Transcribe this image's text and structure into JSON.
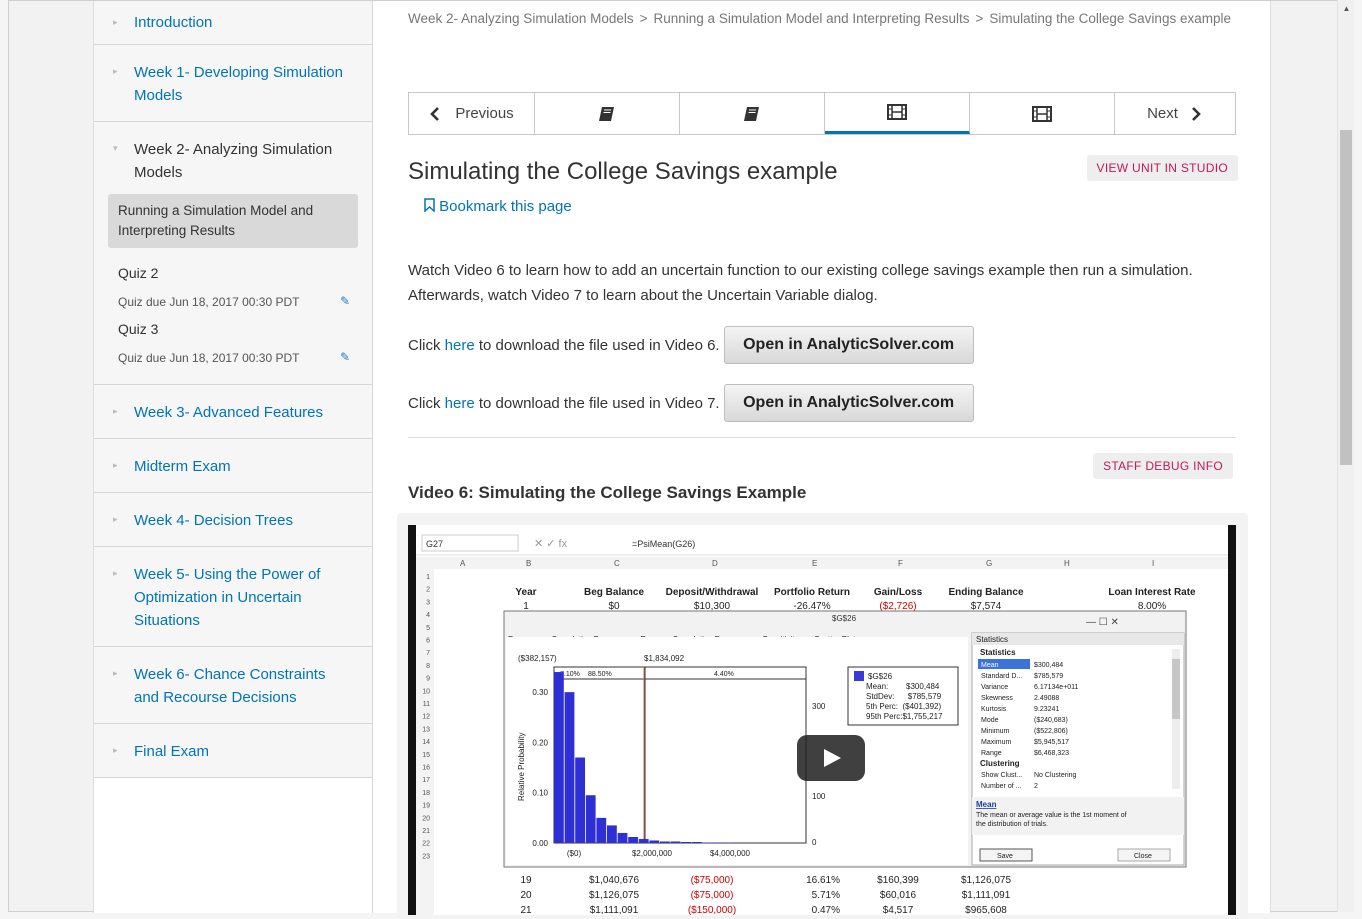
{
  "sidebar": {
    "sections": [
      {
        "title": "Introduction"
      },
      {
        "title": "Week 1- Developing Simulation Models"
      },
      {
        "title": "Week 2- Analyzing Simulation Models"
      },
      {
        "title": "Week 3- Advanced Features"
      },
      {
        "title": "Midterm Exam"
      },
      {
        "title": "Week 4- Decision Trees"
      },
      {
        "title": "Week 5- Using the Power of Optimization in Uncertain Situations"
      },
      {
        "title": "Week 6- Chance Constraints and Recourse Decisions"
      },
      {
        "title": "Final Exam"
      }
    ],
    "week2_items": [
      {
        "title": "Running a Simulation Model and Interpreting Results"
      },
      {
        "title": "Quiz 2",
        "due": "Quiz due Jun 18, 2017 00:30 PDT"
      },
      {
        "title": "Quiz 3",
        "due": "Quiz due Jun 18, 2017 00:30 PDT"
      }
    ]
  },
  "breadcrumb": {
    "part1": "Week 2- Analyzing Simulation Models",
    "part2": "Running a Simulation Model and Interpreting Results",
    "part3": "Simulating the College Savings example",
    "sep": ">"
  },
  "seqnav": {
    "previous": "Previous",
    "next": "Next"
  },
  "unit": {
    "title": "Simulating the College Savings example",
    "studio_button": "VIEW UNIT IN STUDIO",
    "bookmark": "Bookmark this page",
    "intro": "Watch Video 6 to learn how to add an uncertain function to our existing college savings example then run a simulation.  Afterwards, watch Video 7 to learn about the Uncertain Variable dialog.",
    "download1_pre": "Click ",
    "download1_link": "here",
    "download1_post": " to download the file used in Video 6.",
    "download2_pre": "Click ",
    "download2_link": "here",
    "download2_post": " to download the file used in Video 7.",
    "solver_button": "Open in AnalyticSolver.com",
    "debug_button": "STAFF DEBUG INFO",
    "video_title": "Video 6: Simulating the College Savings Example"
  },
  "video": {
    "cell_ref": "G27",
    "formula": "=PsiMean(G26)",
    "columns": [
      "A",
      "B",
      "C",
      "D",
      "E",
      "F",
      "G",
      "H",
      "I"
    ],
    "headers": [
      "Year",
      "Beg Balance",
      "Deposit/Withdrawal",
      "Portfolio Return",
      "Gain/Loss",
      "Ending Balance",
      "Loan Interest Rate"
    ],
    "row3": [
      "1",
      "$0",
      "$10,300",
      "-26.47%",
      "($2,726)",
      "$7,574",
      "8.00%"
    ],
    "bottom_rows": [
      {
        "row": "21",
        "cells": [
          "19",
          "$1,040,676",
          "($75,000)",
          "16.61%",
          "$160,399",
          "$1,126,075"
        ]
      },
      {
        "row": "22",
        "cells": [
          "20",
          "$1,126,075",
          "($75,000)",
          "5.71%",
          "$60,016",
          "$1,111,091"
        ]
      },
      {
        "row": "23",
        "cells": [
          "21",
          "$1,111,091",
          "($150,000)",
          "0.47%",
          "$4,517",
          "$965,608"
        ]
      }
    ],
    "dialog": {
      "title": "$G$26",
      "tabs": [
        "Frequency",
        "Cumulative Frequency",
        "Reverse Cumulative Frequency",
        "Sensitivity",
        "Scatter Plots"
      ],
      "top_left": "($382,157)",
      "top_mid": "$1,834,092",
      "pct1": "7.10%",
      "pct2": "88.50%",
      "pct3": "4.40%",
      "y_label": "Relative Probability",
      "y_ticks": [
        "0.30",
        "0.20",
        "0.10",
        "0.00"
      ],
      "y2_ticks": [
        "300",
        "100",
        "0"
      ],
      "x_ticks": [
        "($0)",
        "$2,000,000",
        "$4,000,000"
      ],
      "legend": {
        "name": "$G$26",
        "mean": "Mean:        $300,484",
        "stddev": "StdDev:      $785,579",
        "p5": "5th Perc:  ($401,392)",
        "p95": "95th Perc:$1,755,217"
      },
      "bars": [
        0.34,
        0.3,
        0.17,
        0.095,
        0.05,
        0.035,
        0.02,
        0.012,
        0.008,
        0.005,
        0.003,
        0.003,
        0.002,
        0.002,
        0.001,
        0.001,
        0.001
      ],
      "stats_header": "Statistics",
      "stats_group": "Statistics",
      "stats": [
        {
          "k": "Mean",
          "v": "$300,484"
        },
        {
          "k": "Standard D...",
          "v": "$785,579"
        },
        {
          "k": "Variance",
          "v": "6.17134e+011"
        },
        {
          "k": "Skewness",
          "v": "2.49088"
        },
        {
          "k": "Kurtosis",
          "v": "9.23241"
        },
        {
          "k": "Mode",
          "v": "($240,683)"
        },
        {
          "k": "Minimum",
          "v": "($522,806)"
        },
        {
          "k": "Maximum",
          "v": "$5,945,517"
        },
        {
          "k": "Range",
          "v": "$6,468,323"
        }
      ],
      "cluster_group": "Clustering",
      "cluster": [
        {
          "k": "Show Clust...",
          "v": "No Clustering"
        },
        {
          "k": "Number of ...",
          "v": "2"
        }
      ],
      "help_title": "Mean",
      "help_text": "The mean or average value is the 1st moment of the distribution of trials.",
      "save": "Save",
      "close": "Close"
    }
  }
}
